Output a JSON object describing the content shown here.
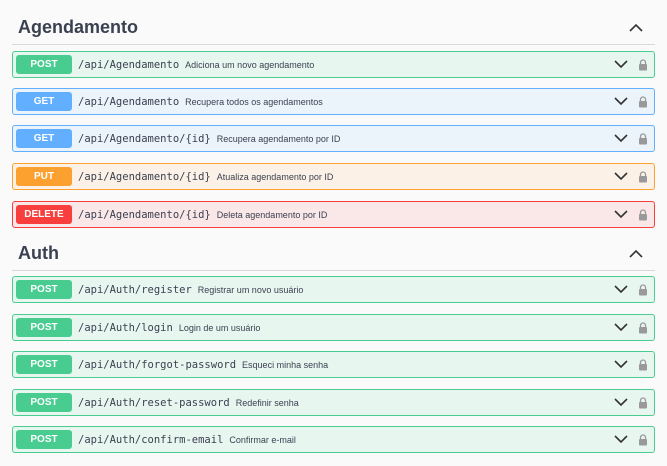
{
  "sections": [
    {
      "title": "Agendamento",
      "operations": [
        {
          "method": "POST",
          "path": "/api/Agendamento",
          "summary": "Adiciona um novo agendamento"
        },
        {
          "method": "GET",
          "path": "/api/Agendamento",
          "summary": "Recupera todos os agendamentos"
        },
        {
          "method": "GET",
          "path": "/api/Agendamento/{id}",
          "summary": "Recupera agendamento por ID"
        },
        {
          "method": "PUT",
          "path": "/api/Agendamento/{id}",
          "summary": "Atualiza agendamento por ID"
        },
        {
          "method": "DELETE",
          "path": "/api/Agendamento/{id}",
          "summary": "Deleta agendamento por ID"
        }
      ]
    },
    {
      "title": "Auth",
      "operations": [
        {
          "method": "POST",
          "path": "/api/Auth/register",
          "summary": "Registrar um novo usuário"
        },
        {
          "method": "POST",
          "path": "/api/Auth/login",
          "summary": "Login de um usuário"
        },
        {
          "method": "POST",
          "path": "/api/Auth/forgot-password",
          "summary": "Esqueci minha senha"
        },
        {
          "method": "POST",
          "path": "/api/Auth/reset-password",
          "summary": "Redefinir senha"
        },
        {
          "method": "POST",
          "path": "/api/Auth/confirm-email",
          "summary": "Confirmar e-mail"
        }
      ]
    }
  ],
  "colors": {
    "post": "#49cc90",
    "get": "#61affe",
    "put": "#fca130",
    "delete": "#f93e3e"
  },
  "icons": {
    "section_toggle": "chevron-up-icon",
    "op_toggle": "chevron-down-icon",
    "auth": "lock-icon"
  }
}
